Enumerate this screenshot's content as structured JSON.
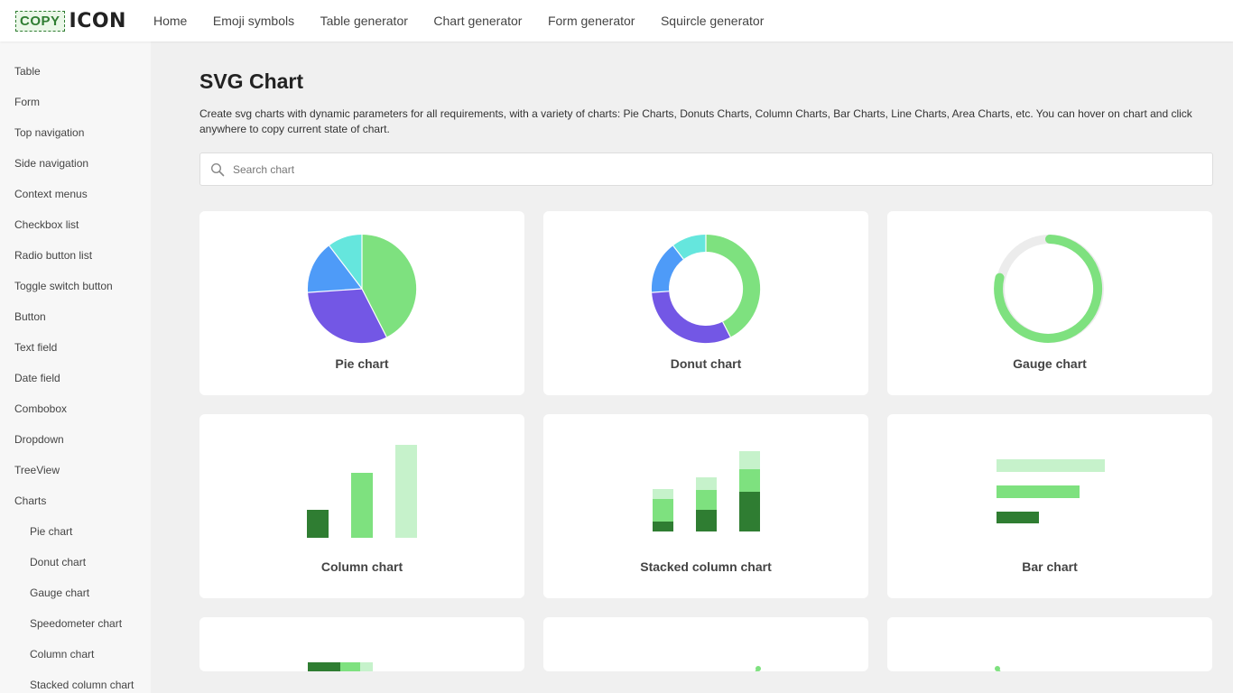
{
  "header": {
    "logo_copy": "COPY",
    "logo_icon": "ICON",
    "nav": [
      "Home",
      "Emoji symbols",
      "Table generator",
      "Chart generator",
      "Form generator",
      "Squircle generator"
    ]
  },
  "sidebar": {
    "items": [
      "Table",
      "Form",
      "Top navigation",
      "Side navigation",
      "Context menus",
      "Checkbox list",
      "Radio button list",
      "Toggle switch button",
      "Button",
      "Text field",
      "Date field",
      "Combobox",
      "Dropdown",
      "TreeView",
      "Charts"
    ],
    "sub_items": [
      "Pie chart",
      "Donut chart",
      "Gauge chart",
      "Speedometer chart",
      "Column chart",
      "Stacked column chart"
    ]
  },
  "main": {
    "title": "SVG Chart",
    "description": "Create svg charts with dynamic parameters for all requirements, with a variety of charts: Pie Charts, Donuts Charts, Column Charts, Bar Charts, Line Charts, Area Charts, etc. You can hover on chart and click anywhere to copy current state of chart.",
    "search_placeholder": "Search chart",
    "cards": [
      "Pie chart",
      "Donut chart",
      "Gauge chart",
      "Column chart",
      "Stacked column chart",
      "Bar chart"
    ]
  },
  "colors": {
    "green": "#7ee17f",
    "dark_green": "#2f7d32",
    "light_green": "#c6f2cb",
    "purple": "#7357e5",
    "blue": "#4e9bf8",
    "cyan": "#65e6dd",
    "track": "#ececec"
  },
  "icons": [
    "search-icon"
  ]
}
